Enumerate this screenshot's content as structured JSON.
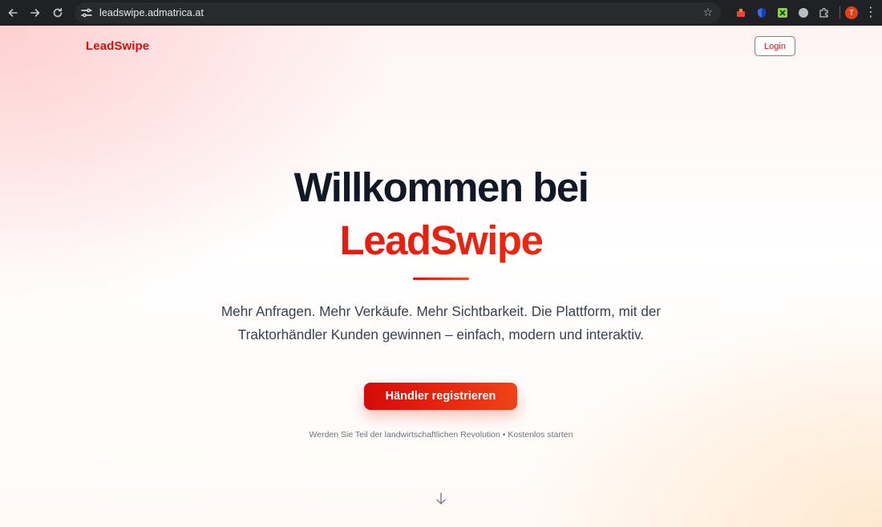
{
  "browser": {
    "url": "leadswipe.admatrica.at",
    "avatar_letter": "T"
  },
  "header": {
    "logo": "LeadSwipe",
    "login_label": "Login"
  },
  "hero": {
    "title_line1": "Willkommen bei",
    "title_line2": "LeadSwipe",
    "tagline_line1": "Mehr Anfragen. Mehr Verkäufe. Mehr Sichtbarkeit. Die Plattform, mit der",
    "tagline_line2": "Traktorhändler Kunden gewinnen – einfach, modern und interaktiv.",
    "cta_label": "Händler registrieren",
    "subnote": "Werden Sie Teil der landwirtschaftlichen Revolution • Kostenlos starten"
  },
  "colors": {
    "brand_red": "#d90f0f",
    "dark_text": "#121826"
  },
  "icons": {
    "back": "back-arrow-icon",
    "forward": "forward-arrow-icon",
    "reload": "reload-icon",
    "site_info": "tune-icon",
    "bookmark": "star-icon",
    "extensions": "puzzle-icon",
    "menu": "more-vert-icon",
    "scroll": "arrow-down-icon"
  }
}
